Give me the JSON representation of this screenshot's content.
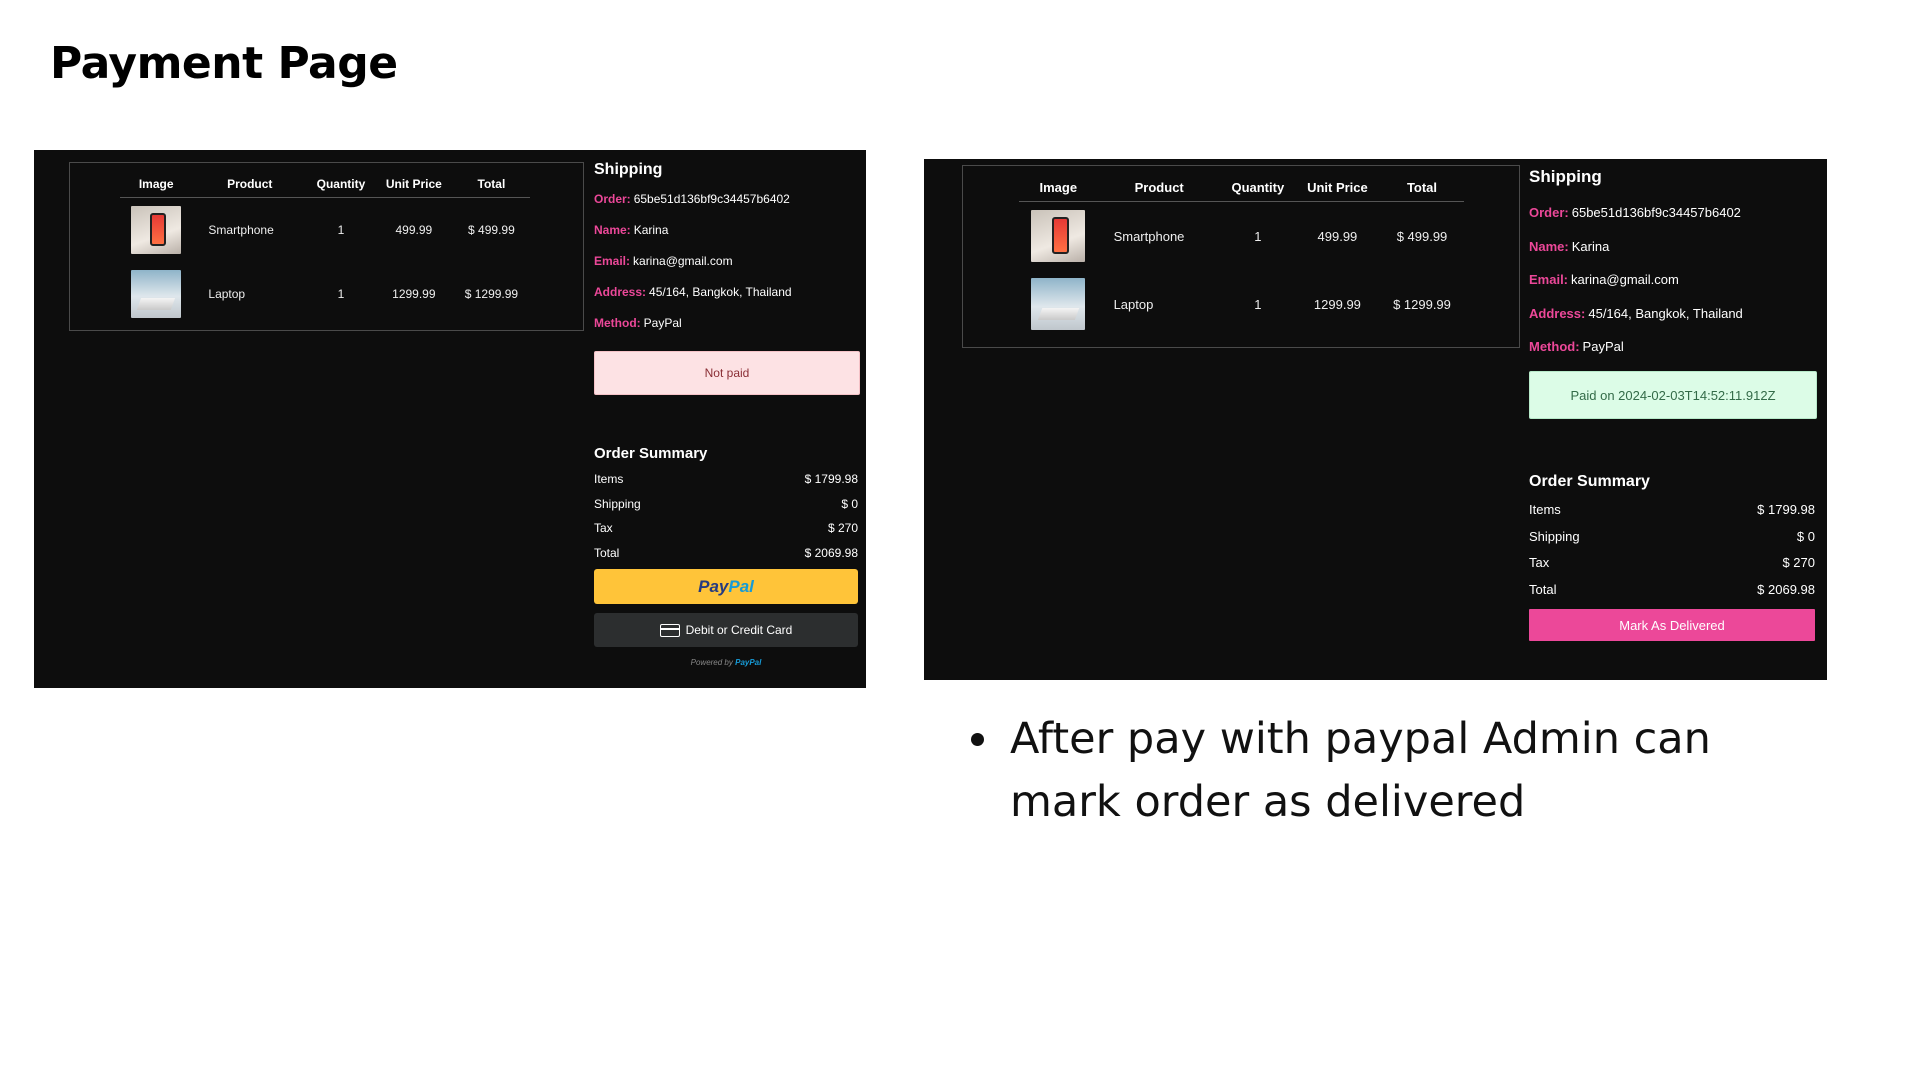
{
  "slide": {
    "title": "Payment Page",
    "bullets": [
      "After pay with paypal Admin can mark order as delivered"
    ]
  },
  "table": {
    "headers": [
      "Image",
      "Product",
      "Quantity",
      "Unit Price",
      "Total"
    ],
    "rows": [
      {
        "image_icon": "smartphone-photo",
        "product": "Smartphone",
        "quantity": "1",
        "unit_price": "499.99",
        "total": "$ 499.99"
      },
      {
        "image_icon": "laptop-photo",
        "product": "Laptop",
        "quantity": "1",
        "unit_price": "1299.99",
        "total": "$ 1299.99"
      }
    ]
  },
  "shipping": {
    "title": "Shipping",
    "order_label": "Order:",
    "order_value": "65be51d136bf9c34457b6402",
    "name_label": "Name:",
    "name_value": "Karina",
    "email_label": "Email:",
    "email_value": "karina@gmail.com",
    "address_label": "Address:",
    "address_value": "45/164, Bangkok, Thailand",
    "method_label": "Method:",
    "method_value": "PayPal"
  },
  "status_before": "Not paid",
  "status_after": "Paid on 2024-02-03T14:52:11.912Z",
  "summary": {
    "title": "Order Summary",
    "items_label": "Items",
    "items_value": "$ 1799.98",
    "shipping_label": "Shipping",
    "shipping_value": "$ 0",
    "tax_label": "Tax",
    "tax_value": "$ 270",
    "total_label": "Total",
    "total_value": "$ 2069.98"
  },
  "paypal": {
    "brand_a": "Pay",
    "brand_b": "Pal",
    "card_label": "Debit or Credit Card",
    "powered_by": "Powered by",
    "powered_brand": "PayPal"
  },
  "admin": {
    "mark_delivered_label": "Mark As Delivered"
  },
  "colors": {
    "accent": "#ec4899",
    "panel_bg": "#0d0d0d",
    "paypal_yellow": "#ffc439",
    "not_paid_bg": "#fde2e4",
    "paid_bg": "#dcfce7"
  }
}
